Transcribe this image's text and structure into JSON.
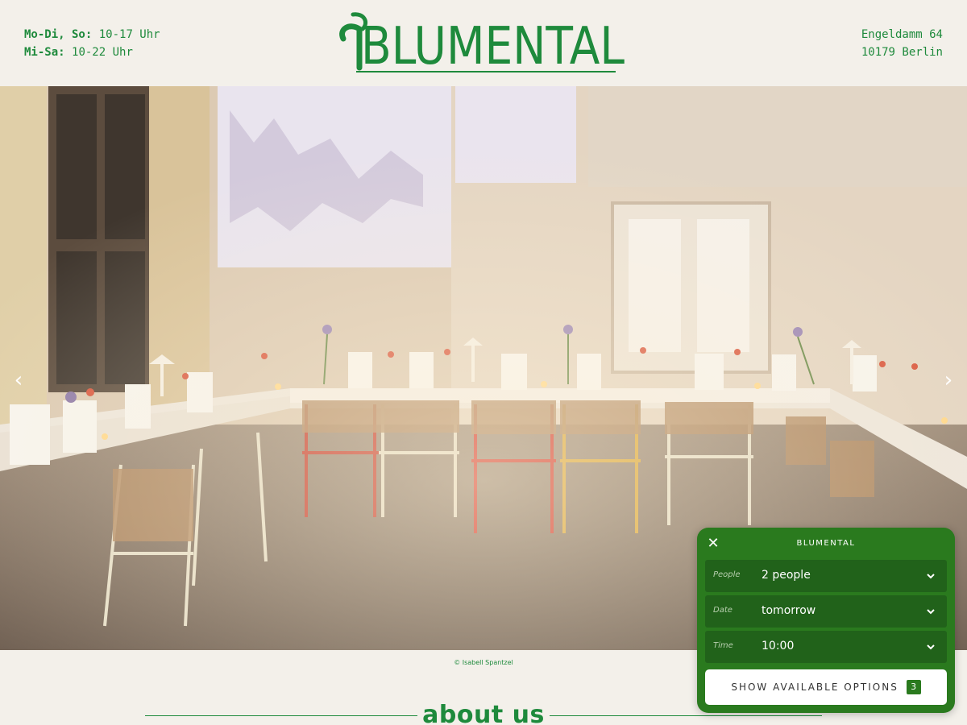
{
  "header": {
    "hours_line1_days": "Mo-Di, So:",
    "hours_line1_time": "10-17 Uhr",
    "hours_line2_days": "Mi-Sa:",
    "hours_line2_time": "10-22 Uhr",
    "logo_text": "BLUMENTAL",
    "address_line1": "Engeldamm 64",
    "address_line2": "10179 Berlin"
  },
  "hero": {
    "prev_arrow": "‹",
    "next_arrow": "›",
    "credit": "© Isabell Spantzel"
  },
  "about": {
    "title": "about us"
  },
  "booking_widget": {
    "close": "✕",
    "title": "BLUMENTAL",
    "fields": [
      {
        "label": "People",
        "value": "2 people"
      },
      {
        "label": "Date",
        "value": "tomorrow"
      },
      {
        "label": "Time",
        "value": "10:00"
      }
    ],
    "show_button_label": "SHOW AVAILABLE OPTIONS",
    "options_count": "3"
  },
  "colors": {
    "brand_green": "#1e8a3c",
    "widget_green": "#2a7a1e",
    "background": "#f3f0ea"
  }
}
